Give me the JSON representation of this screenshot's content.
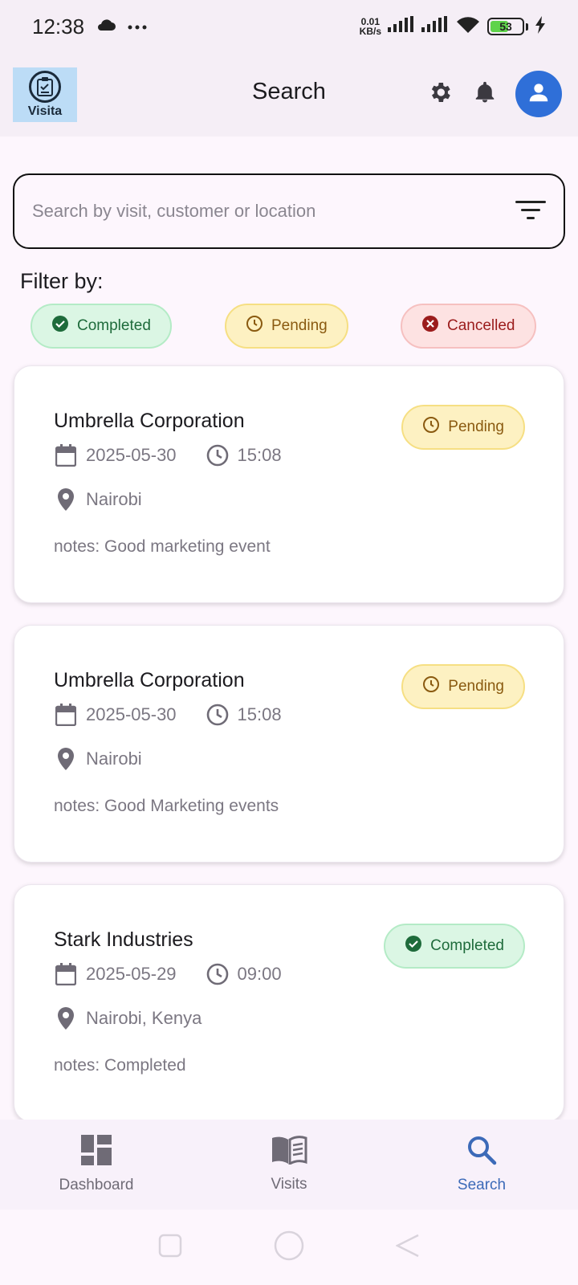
{
  "status_bar": {
    "time": "12:38",
    "netspeed_value": "0.01",
    "netspeed_unit": "KB/s",
    "battery": "53"
  },
  "app_bar": {
    "logo_text": "Visita",
    "title": "Search"
  },
  "search": {
    "placeholder": "Search by visit, customer or location",
    "value": ""
  },
  "filters": {
    "label": "Filter by:",
    "chips": [
      {
        "label": "Completed",
        "status": "completed"
      },
      {
        "label": "Pending",
        "status": "pending"
      },
      {
        "label": "Cancelled",
        "status": "cancelled"
      }
    ]
  },
  "visits": [
    {
      "customer": "Umbrella Corporation",
      "status": "Pending",
      "date": "2025-05-30",
      "time": "15:08",
      "location": "Nairobi",
      "notes": "notes: Good marketing event"
    },
    {
      "customer": "Umbrella Corporation",
      "status": "Pending",
      "date": "2025-05-30",
      "time": "15:08",
      "location": "Nairobi",
      "notes": "notes: Good Marketing events"
    },
    {
      "customer": "Stark Industries",
      "status": "Completed",
      "date": "2025-05-29",
      "time": "09:00",
      "location": "Nairobi, Kenya",
      "notes": "notes: Completed"
    }
  ],
  "bottom_nav": {
    "items": [
      {
        "label": "Dashboard",
        "icon": "dashboard-icon"
      },
      {
        "label": "Visits",
        "icon": "book-icon"
      },
      {
        "label": "Search",
        "icon": "search-icon",
        "active": true
      }
    ]
  },
  "colors": {
    "accent": "#3c6ab8",
    "completed": "#1e6b3b",
    "pending": "#8a5a10",
    "cancelled": "#9b1c1c",
    "avatar": "#2f6fd8"
  }
}
